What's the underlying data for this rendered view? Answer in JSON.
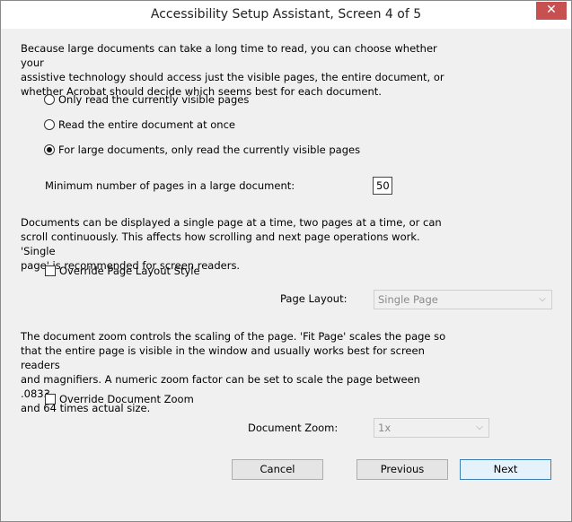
{
  "window": {
    "title": "Accessibility Setup Assistant, Screen 4 of 5",
    "close_label": "✕"
  },
  "reading": {
    "description_lines": [
      "Because large documents can take a long time to read, you can choose whether your",
      "assistive technology should access just the visible pages, the entire document, or",
      "whether Acrobat should decide which seems best for each document."
    ],
    "options": [
      {
        "label": "Only read the currently visible pages",
        "checked": false
      },
      {
        "label": "Read the entire document at once",
        "checked": false
      },
      {
        "label": "For large documents, only read the currently visible pages",
        "checked": true
      }
    ],
    "min_pages_label": "Minimum number of pages in a large document:",
    "min_pages_value": "50"
  },
  "layout": {
    "description_lines": [
      "Documents can be displayed a single page at a time, two pages at a time, or can",
      "scroll continuously. This affects how scrolling and next page operations work. 'Single",
      "page' is recommended for screen readers."
    ],
    "override_label": "Override Page Layout Style",
    "override_checked": false,
    "page_layout_label": "Page Layout:",
    "page_layout_value": "Single Page"
  },
  "zoom": {
    "description_lines": [
      "The document zoom controls the scaling of the page. 'Fit Page' scales the page so",
      "that the entire page is visible in the window and usually works best for screen readers",
      "and magnifiers. A numeric zoom factor can be set to scale the page between .0833",
      "and 64 times actual size."
    ],
    "override_label": "Override Document Zoom",
    "override_checked": false,
    "document_zoom_label": "Document Zoom:",
    "document_zoom_value": "1x"
  },
  "buttons": {
    "cancel": "Cancel",
    "previous": "Previous",
    "next": "Next"
  }
}
